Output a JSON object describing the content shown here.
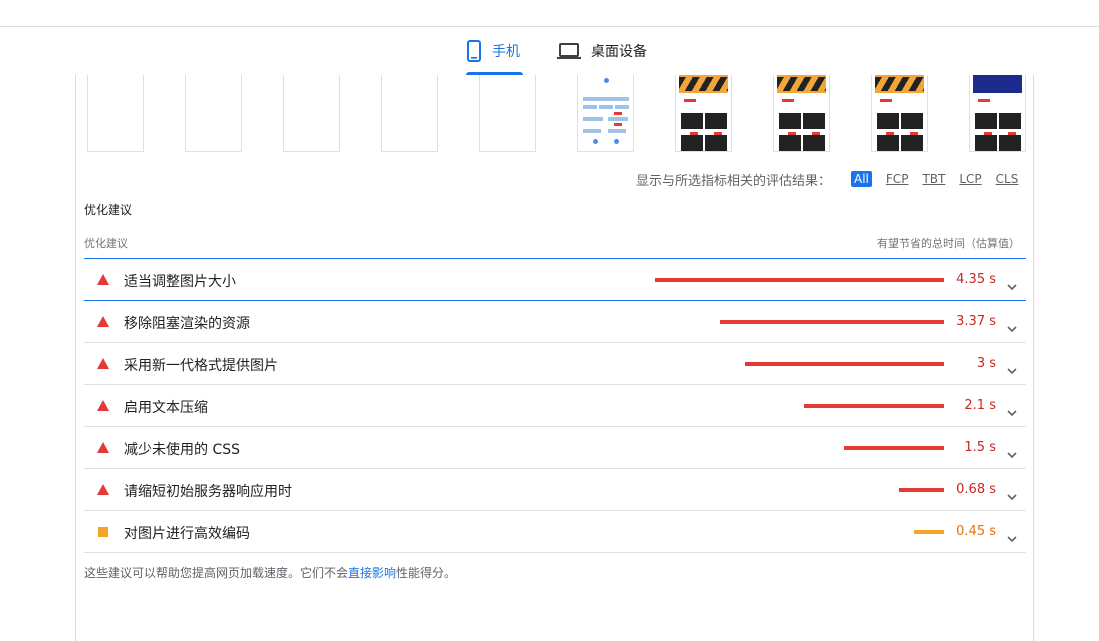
{
  "tabs": [
    {
      "label": "手机",
      "icon": "phone-icon",
      "active": true
    },
    {
      "label": "桌面设备",
      "icon": "laptop-icon",
      "active": false
    }
  ],
  "filter": {
    "label": "显示与所选指标相关的评估结果：",
    "chips": [
      "All",
      "FCP",
      "TBT",
      "LCP",
      "CLS"
    ],
    "active": "All"
  },
  "section_title": "优化建议",
  "table": {
    "col_left": "优化建议",
    "col_right": "有望节省的总时间（估算值）",
    "max_savings_s": 4.35,
    "rows": [
      {
        "title": "适当调整图片大小",
        "value": "4.35 s",
        "seconds": 4.35,
        "severity": "fail"
      },
      {
        "title": "移除阻塞渲染的资源",
        "value": "3.37 s",
        "seconds": 3.37,
        "severity": "fail"
      },
      {
        "title": "采用新一代格式提供图片",
        "value": "3 s",
        "seconds": 3.0,
        "severity": "fail"
      },
      {
        "title": "启用文本压缩",
        "value": "2.1 s",
        "seconds": 2.1,
        "severity": "fail"
      },
      {
        "title": "减少未使用的 CSS",
        "value": "1.5 s",
        "seconds": 1.5,
        "severity": "fail"
      },
      {
        "title": "请缩短初始服务器响应用时",
        "value": "0.68 s",
        "seconds": 0.68,
        "severity": "fail"
      },
      {
        "title": "对图片进行高效编码",
        "value": "0.45 s",
        "seconds": 0.45,
        "severity": "average"
      }
    ]
  },
  "footer": {
    "before": "这些建议可以帮助您提高网页加载速度。它们不会",
    "link": "直接影响",
    "after": "性能得分。"
  },
  "colors": {
    "accent": "#1a73e8",
    "fail": "#e53935",
    "average": "#f4a429"
  }
}
